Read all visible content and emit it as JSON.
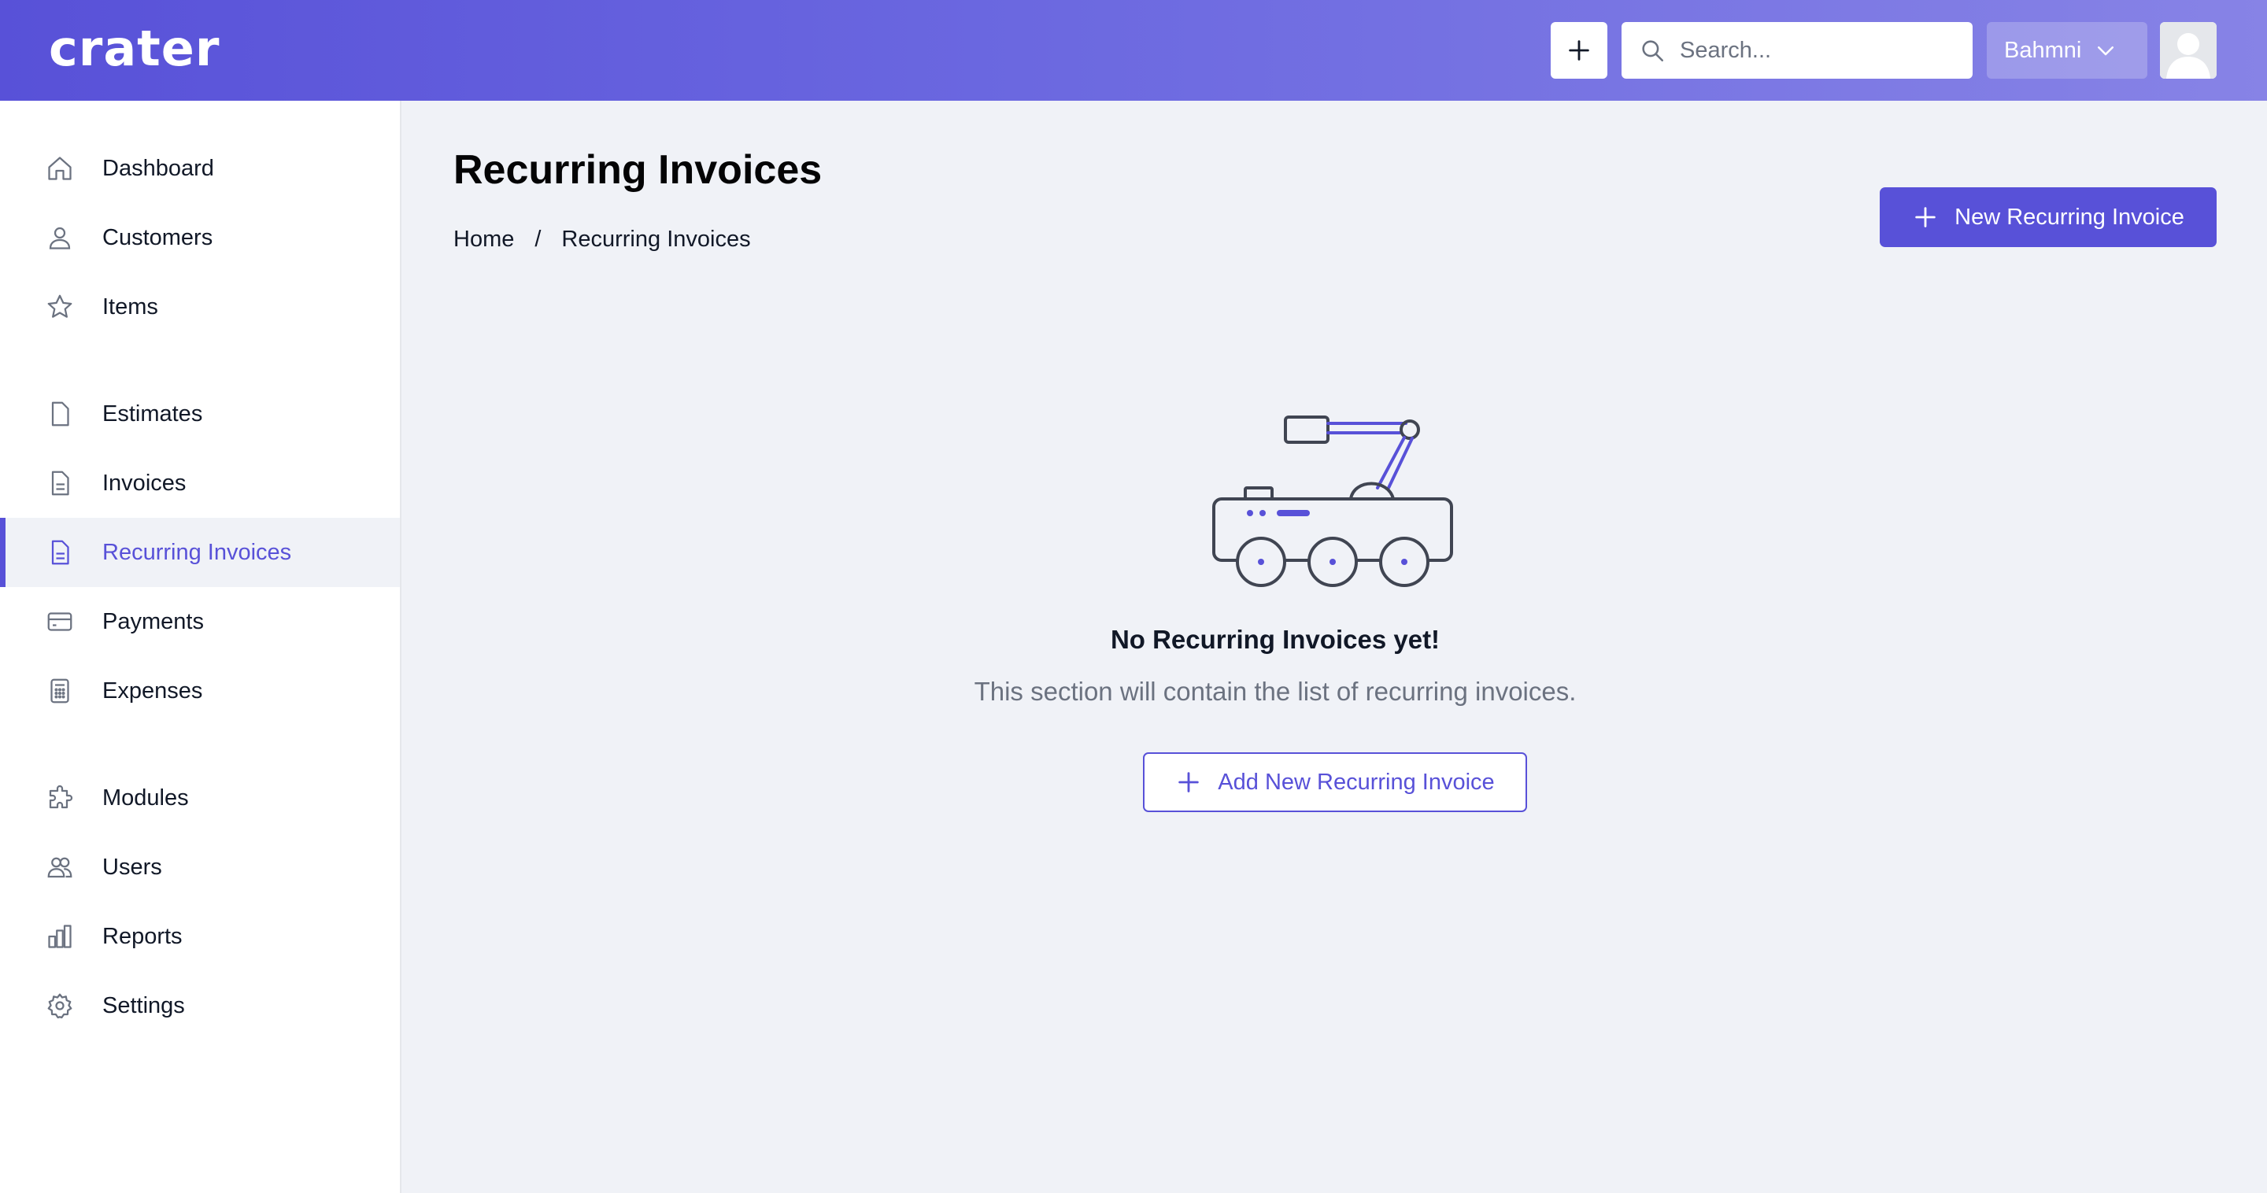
{
  "app": {
    "logo_text": "crater",
    "colors": {
      "primary": "#5851d8",
      "header_start": "#5851d8",
      "header_end": "#8783e6",
      "background": "#f0f2f7"
    }
  },
  "header": {
    "add_icon": "plus-icon",
    "search_placeholder": "Search...",
    "company_name": "Bahmni",
    "company_dropdown_icon": "chevron-down-icon",
    "avatar_icon": "user-avatar-icon"
  },
  "sidebar": {
    "active_item": "Recurring Invoices",
    "items": [
      {
        "label": "Dashboard",
        "icon": "home-icon"
      },
      {
        "label": "Customers",
        "icon": "user-icon"
      },
      {
        "label": "Items",
        "icon": "star-icon"
      },
      {
        "label": "Estimates",
        "icon": "document-icon"
      },
      {
        "label": "Invoices",
        "icon": "document-text-icon"
      },
      {
        "label": "Recurring Invoices",
        "icon": "document-text-icon"
      },
      {
        "label": "Payments",
        "icon": "credit-card-icon"
      },
      {
        "label": "Expenses",
        "icon": "calculator-icon"
      },
      {
        "label": "Modules",
        "icon": "puzzle-icon"
      },
      {
        "label": "Users",
        "icon": "users-icon"
      },
      {
        "label": "Reports",
        "icon": "chart-bar-icon"
      },
      {
        "label": "Settings",
        "icon": "cog-icon"
      }
    ]
  },
  "main": {
    "title": "Recurring Invoices",
    "breadcrumb": [
      "Home",
      "/",
      "Recurring Invoices"
    ],
    "new_button_label": "New Recurring Invoice",
    "empty_state": {
      "illustration": "robot-rover-illustration",
      "title": "No Recurring Invoices yet!",
      "description": "This section will contain the list of recurring invoices.",
      "button_label": "Add New Recurring Invoice"
    }
  }
}
